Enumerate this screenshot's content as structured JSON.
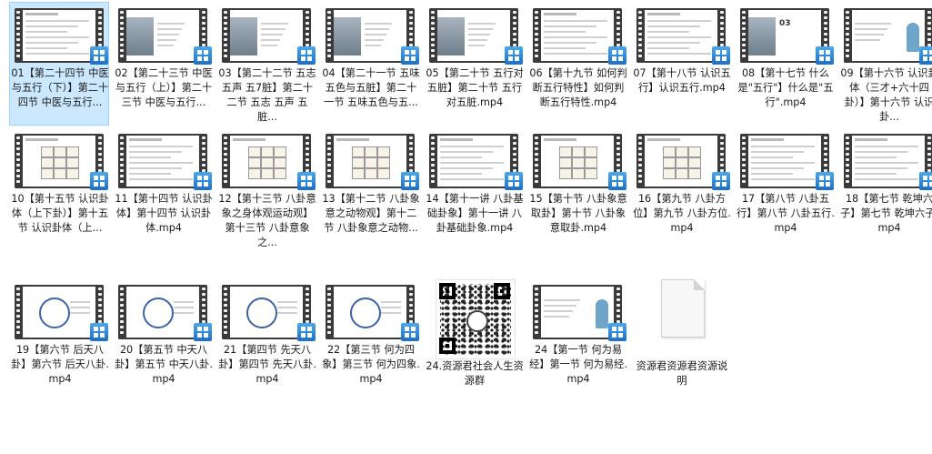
{
  "items": [
    {
      "label": "01【第二十四节 中医与五行（下）】第二十四节 中医与五行...",
      "type": "video",
      "selected": true,
      "style": "text"
    },
    {
      "label": "02【第二十三节 中医与五行（上）】第二十三节 中医与五行...",
      "type": "video",
      "style": "mountain"
    },
    {
      "label": "03【第二十二节 五志 五声 五7脏】第二十二节 五志 五声 五脏...",
      "type": "video",
      "style": "mountain"
    },
    {
      "label": "04【第二十一节 五味五色与五脏】第二十一节 五味五色与五...",
      "type": "video",
      "style": "mountain"
    },
    {
      "label": "05【第二十节 五行对五脏】第二十节 五行对五脏.mp4",
      "type": "video",
      "style": "mountain"
    },
    {
      "label": "06【第十九节 如何判断五行特性】如何判断五行特性.mp4",
      "type": "video",
      "style": "text"
    },
    {
      "label": "07【第十八节 认识五行】认识五行.mp4",
      "type": "video",
      "style": "text"
    },
    {
      "label": "08【第十七节 什么是\"五行\"】什么是\"五行\".mp4",
      "type": "video",
      "style": "title",
      "big": "03"
    },
    {
      "label": "09【第十六节 认识卦体（三才+六十四卦）】第十六节 认识卦...",
      "type": "video",
      "style": "person"
    },
    {
      "label": "10【第十五节 认识卦体（上下卦）】第十五节 认识卦体（上...",
      "type": "video",
      "style": "table"
    },
    {
      "label": "11【第十四节 认识卦体】第十四节 认识卦体.mp4",
      "type": "video",
      "style": "text"
    },
    {
      "label": "12【第十三节 八卦意象之身体观运动观】第十三节 八卦意象之...",
      "type": "video",
      "style": "table"
    },
    {
      "label": "13【第十二节 八卦象意之动物观】第十二节 八卦象意之动物...",
      "type": "video",
      "style": "table"
    },
    {
      "label": "14【第十一讲 八卦基础卦象】第十一讲 八卦基础卦象.mp4",
      "type": "video",
      "style": "text"
    },
    {
      "label": "15【第十节 八卦象意取卦】第十节 八卦象意取卦.mp4",
      "type": "video",
      "style": "table"
    },
    {
      "label": "16【第九节 八卦方位】第九节 八卦方位.mp4",
      "type": "video",
      "style": "table"
    },
    {
      "label": "17【第八节 八卦五行】第八节 八卦五行.mp4",
      "type": "video",
      "style": "text"
    },
    {
      "label": "18【第七节 乾坤六子】第七节 乾坤六子.mp4",
      "type": "video",
      "style": "text"
    },
    {
      "label": "19【第六节 后天八卦】第六节 后天八卦.mp4",
      "type": "video",
      "style": "circle"
    },
    {
      "label": "20【第五节 中天八卦】第五节 中天八卦.mp4",
      "type": "video",
      "style": "circle"
    },
    {
      "label": "21【第四节 先天八卦】第四节 先天八卦.mp4",
      "type": "video",
      "style": "circle"
    },
    {
      "label": "22【第三节 何为四象】第三节 何为四象.mp4",
      "type": "video",
      "style": "circle"
    },
    {
      "label": "24.资源君社会人生资源群",
      "type": "qr"
    },
    {
      "label": "24【第一节 何为易经】第一节 何为易经.mp4",
      "type": "video",
      "style": "person"
    },
    {
      "label": "资源君资源君资源说明",
      "type": "doc"
    }
  ]
}
